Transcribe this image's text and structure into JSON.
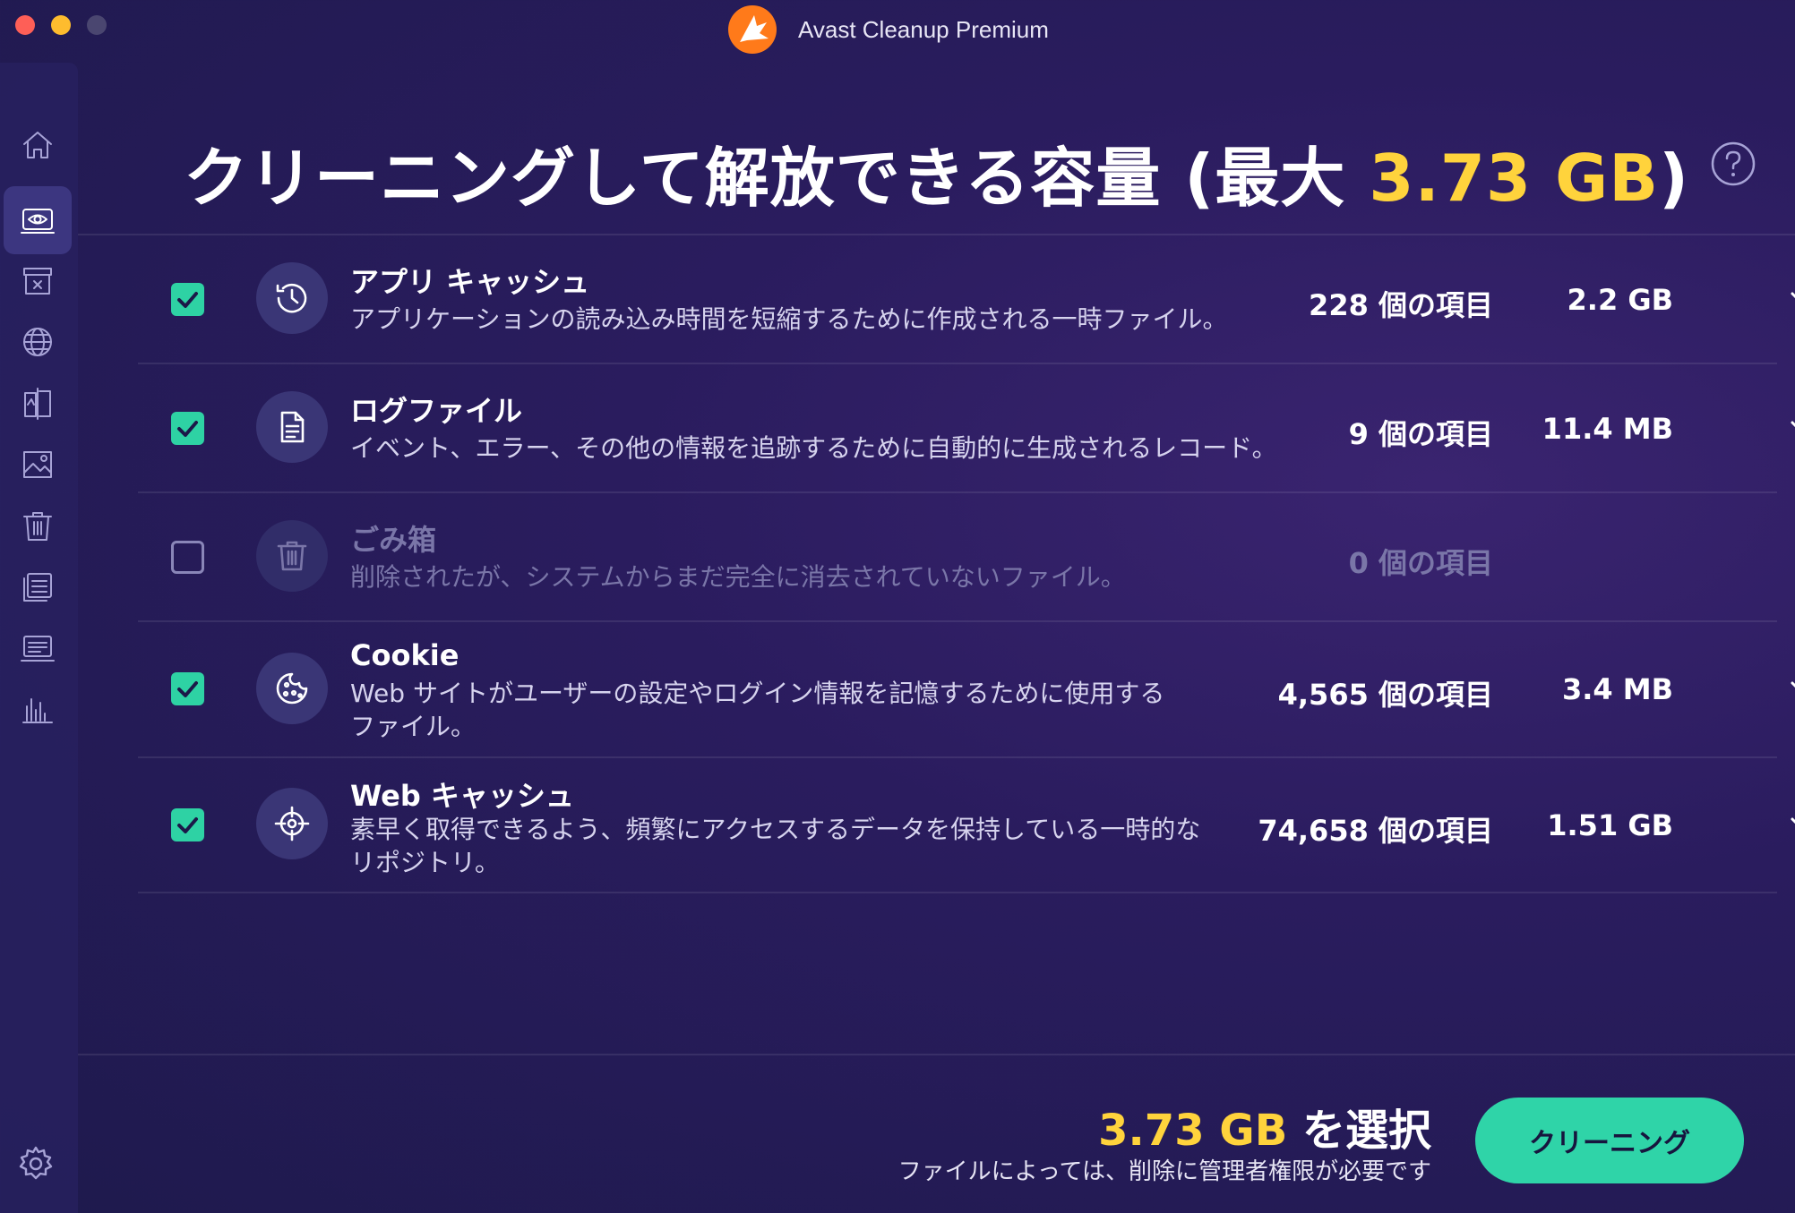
{
  "window": {
    "app_title": "Avast Cleanup Premium"
  },
  "sidebar": {
    "items": [
      {
        "name": "home-icon",
        "active": false
      },
      {
        "name": "eye-icon",
        "active": true
      },
      {
        "name": "archive-icon",
        "active": false
      },
      {
        "name": "globe-icon",
        "active": false
      },
      {
        "name": "duplicate-icon",
        "active": false
      },
      {
        "name": "photo-icon",
        "active": false
      },
      {
        "name": "trash-icon",
        "active": false
      },
      {
        "name": "apps-icon",
        "active": false
      },
      {
        "name": "disk-icon",
        "active": false
      },
      {
        "name": "stats-icon",
        "active": false
      }
    ],
    "settings_icon": "gear-icon"
  },
  "header": {
    "title_prefix": "クリーニングして解放できる容量 (最大 ",
    "title_value": "3.73 GB",
    "title_suffix": ")"
  },
  "rows": [
    {
      "title": "アプリ キャッシュ",
      "desc": "アプリケーションの読み込み時間を短縮するために作成される一時ファイル。",
      "count": "228 個の項目",
      "size": "2.2 GB",
      "checked": true,
      "icon": "history-icon"
    },
    {
      "title": "ログファイル",
      "desc": "イベント、エラー、その他の情報を追跡するために自動的に生成されるレコード。",
      "count": "9 個の項目",
      "size": "11.4 MB",
      "checked": true,
      "icon": "document-icon"
    },
    {
      "title": "ごみ箱",
      "desc": "削除されたが、システムからまだ完全に消去されていないファイル。",
      "count": "0 個の項目",
      "size": "",
      "checked": false,
      "icon": "trash-icon"
    },
    {
      "title": "Cookie",
      "desc": "Web サイトがユーザーの設定やログイン情報を記憶するために使用するファイル。",
      "count": "4,565 個の項目",
      "size": "3.4 MB",
      "checked": true,
      "icon": "cookie-icon"
    },
    {
      "title": "Web キャッシュ",
      "desc": "素早く取得できるよう、頻繁にアクセスするデータを保持している一時的なリポジトリ。",
      "count": "74,658 個の項目",
      "size": "1.51 GB",
      "checked": true,
      "icon": "crosshair-icon"
    }
  ],
  "footer": {
    "total_value": "3.73 GB",
    "total_suffix": " を選択",
    "note": "ファイルによっては、削除に管理者権限が必要です",
    "clean_button": "クリーニング"
  },
  "colors": {
    "accent_yellow": "#ffd33c",
    "accent_green": "#2fd4a8",
    "background": "#241c56"
  }
}
